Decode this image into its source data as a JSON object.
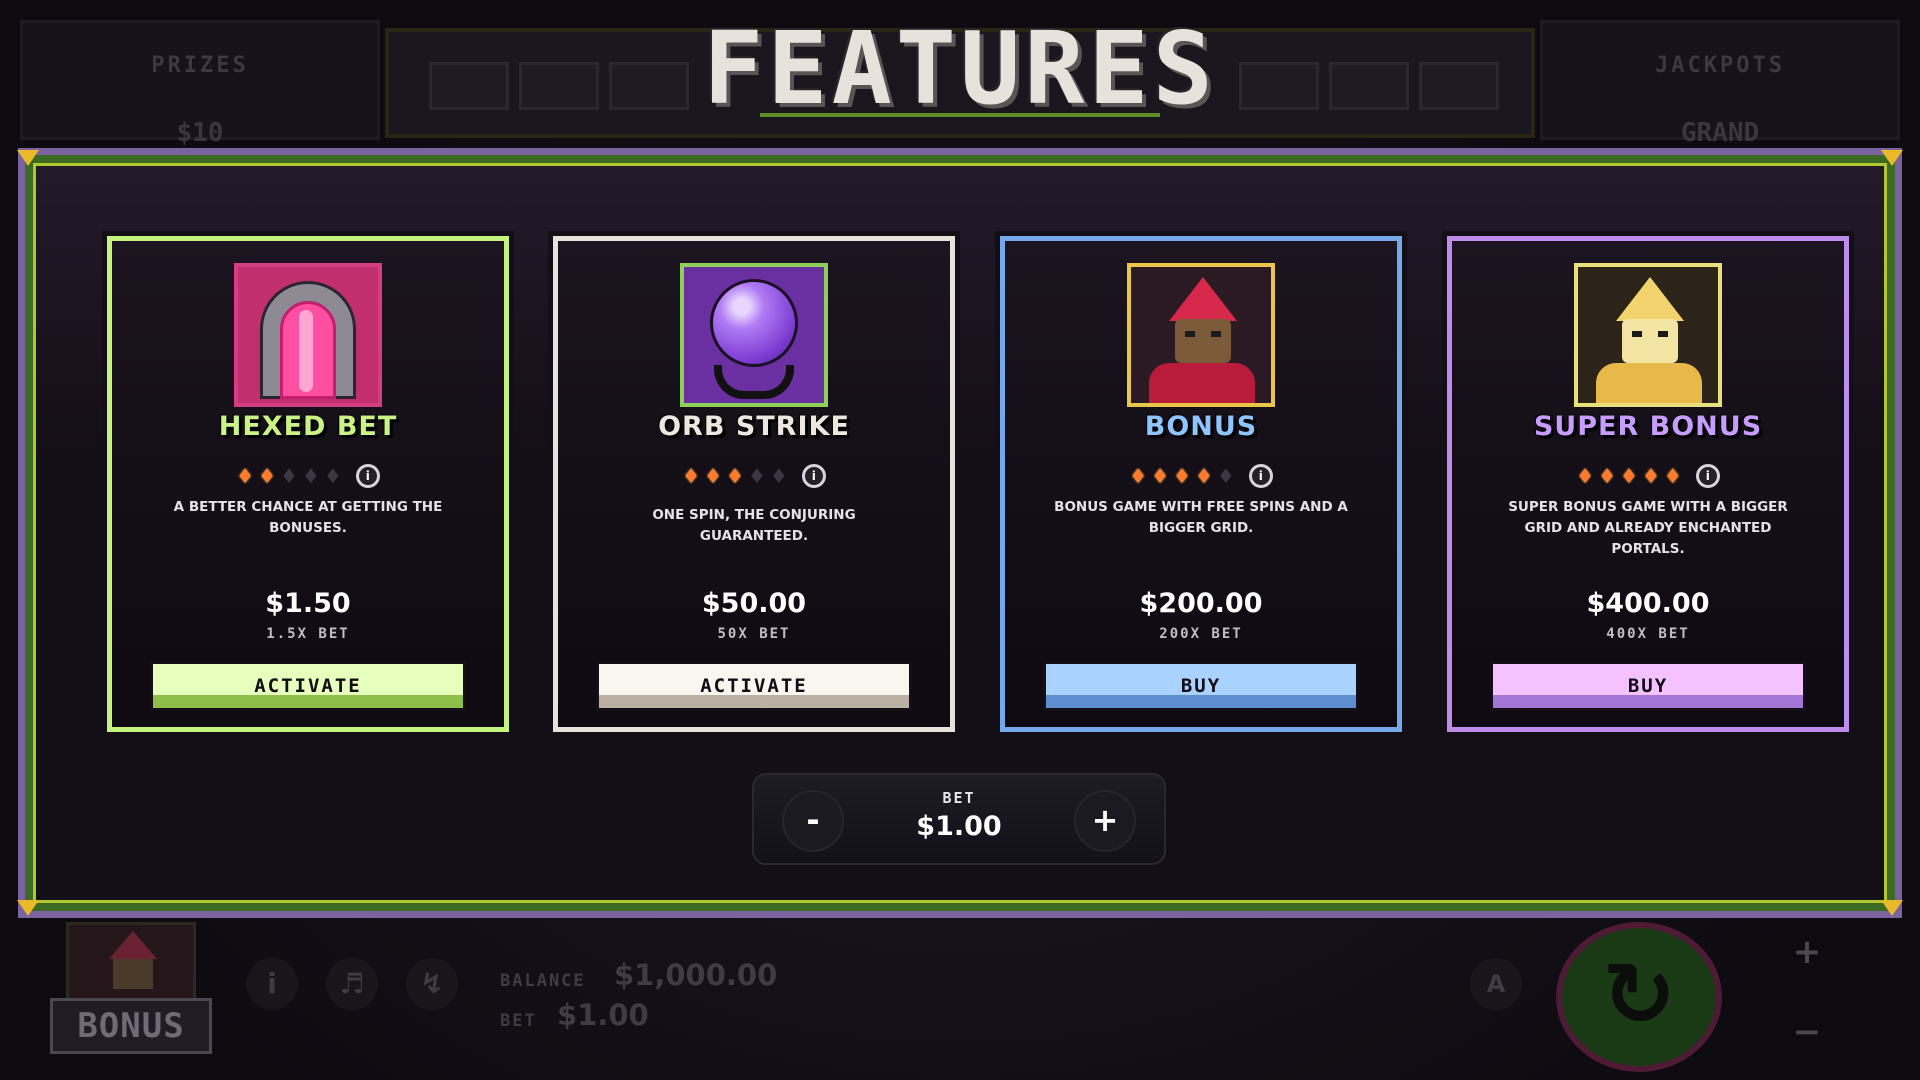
{
  "background": {
    "prizes_title": "PRIZES",
    "prizes_value": "$10",
    "jackpots_title": "JACKPOTS",
    "jackpots_value": "GRAND"
  },
  "modal": {
    "title": "FEATURES"
  },
  "cards": [
    {
      "title": "HEXED BET",
      "icon": "portal-icon",
      "volatility": 2,
      "volatility_max": 5,
      "description": "A better chance at getting the bonuses.",
      "price": "$1.50",
      "multiplier": "1.5X BET",
      "button": "ACTIVATE",
      "accent": "#c6f27f"
    },
    {
      "title": "ORB STRIKE",
      "icon": "crystal-orb-icon",
      "volatility": 3,
      "volatility_max": 5,
      "description": "One spin, the conjuring guaranteed.",
      "price": "$50.00",
      "multiplier": "50X BET",
      "button": "ACTIVATE",
      "accent": "#e7e2db"
    },
    {
      "title": "BONUS",
      "icon": "wizard-icon",
      "volatility": 4,
      "volatility_max": 5,
      "description": "Bonus game with free spins and a bigger grid.",
      "price": "$200.00",
      "multiplier": "200X BET",
      "button": "BUY",
      "accent": "#74a8ea"
    },
    {
      "title": "SUPER BONUS",
      "icon": "golden-wizard-icon",
      "volatility": 5,
      "volatility_max": 5,
      "description": "Super bonus game with a bigger grid and already enchanted portals.",
      "price": "$400.00",
      "multiplier": "400X BET",
      "button": "BUY",
      "accent": "#bc8dec"
    }
  ],
  "bet_control": {
    "label": "BET",
    "value": "$1.00",
    "minus": "-",
    "plus": "+"
  },
  "hud": {
    "bonus_label": "BONUS",
    "balance_label": "BALANCE",
    "balance_value": "$1,000.00",
    "bet_label": "BET",
    "bet_value": "$1.00",
    "info_icon": "i",
    "auto_icon": "A",
    "spin_icon": "↻",
    "side_plus": "+",
    "side_minus": "−"
  }
}
